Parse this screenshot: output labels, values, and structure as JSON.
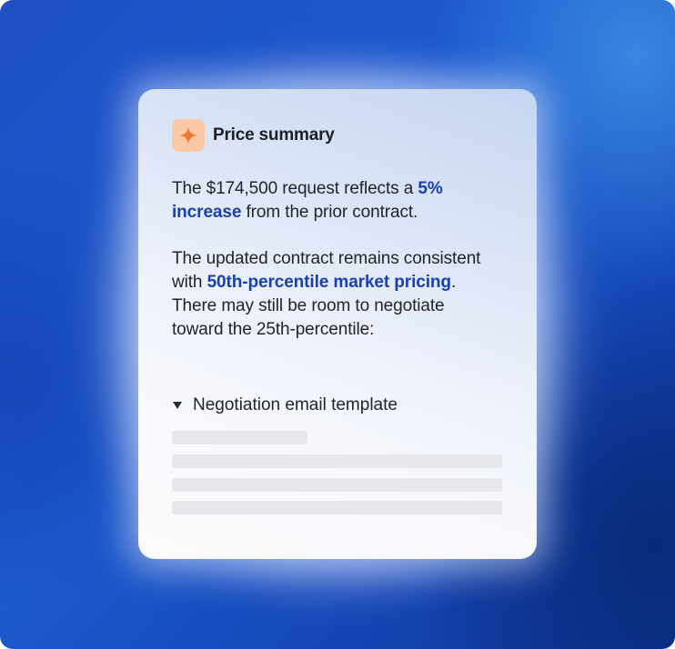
{
  "card": {
    "icon": "sparkle-icon",
    "title": "Price summary",
    "paragraph1": {
      "text_before": "The $174,500 request reflects a ",
      "highlight": "5% increase",
      "text_after": " from the prior contract."
    },
    "paragraph2": {
      "text_before": "The updated contract remains consistent with ",
      "highlight": "50th-percentile market pricing",
      "text_after": ". There may still be room to negotiate toward the 25th-percentile:"
    },
    "disclosure": {
      "label": "Negotiation email template",
      "state": "expanded",
      "content": "loading"
    }
  },
  "colors": {
    "highlight": "#1940b0",
    "badge_bg": "#fbc9a5",
    "icon": "#f07a2c",
    "background": "#1d5ad0"
  }
}
